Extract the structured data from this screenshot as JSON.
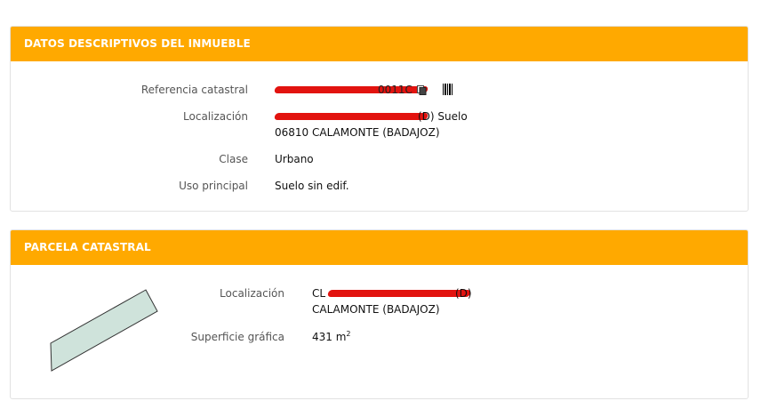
{
  "descriptive": {
    "title": "DATOS DESCRIPTIVOS DEL INMUEBLE",
    "referencia_label": "Referencia catastral",
    "referencia_value": "0011C",
    "localizacion_label": "Localización",
    "localizacion_line1": "(D) Suelo",
    "localizacion_line2": "06810 CALAMONTE (BADAJOZ)",
    "clase_label": "Clase",
    "clase_value": "Urbano",
    "uso_label": "Uso principal",
    "uso_value": "Suelo sin edif."
  },
  "parcela": {
    "title": "PARCELA CATASTRAL",
    "localizacion_label": "Localización",
    "localizacion_prefix": "CL",
    "localizacion_suffix": "(D)",
    "localizacion_line2": "CALAMONTE (BADAJOZ)",
    "superficie_label": "Superficie gráfica",
    "superficie_value": "431 m",
    "superficie_unit_sup": "2"
  },
  "icons": {
    "copy": "copy-icon",
    "barcode": "barcode-icon"
  },
  "colors": {
    "header": "#ffa900",
    "redaction": "#e2130f",
    "parcel_fill": "#cfe3db"
  }
}
